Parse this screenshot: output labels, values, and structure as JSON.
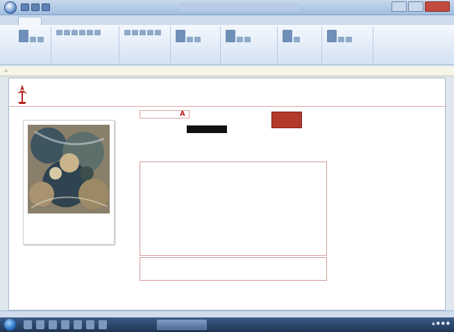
{
  "app": {
    "window_title": "",
    "tabs": [],
    "window_buttons": {
      "minimize": "",
      "maximize": "",
      "close": ""
    }
  },
  "ribbon": {
    "group_labels": []
  },
  "infobar": {
    "text": []
  },
  "banner": {
    "title": "",
    "subtitle": ""
  },
  "form": {
    "fields": [
      {
        "label": "",
        "value": ""
      },
      {
        "label": "",
        "value": ""
      },
      {
        "label": "",
        "value": ""
      },
      {
        "label": "",
        "value": ""
      }
    ],
    "marker": "A",
    "go_button": "",
    "detail_label": "",
    "note_label": ""
  },
  "statusbar": {
    "text": ""
  },
  "colors": {
    "accent_red": "#b13a2c",
    "title_red": "#b62220",
    "ribbon_blue": "#d4e2f3",
    "taskbar": "#2a4468"
  },
  "icons": [
    "office-orb-icon",
    "save-icon",
    "undo-icon",
    "redo-icon",
    "minimize-icon",
    "maximize-icon",
    "close-icon",
    "start-icon"
  ]
}
